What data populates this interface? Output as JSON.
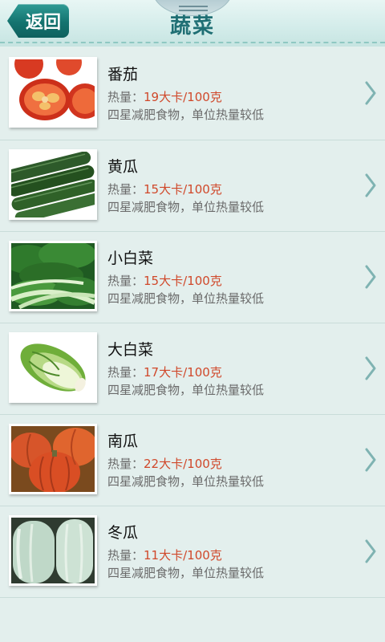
{
  "header": {
    "back_label": "返回",
    "title": "蔬菜"
  },
  "calorie_prefix": "热量：",
  "items": [
    {
      "name": "番茄",
      "calories": "19大卡/100克",
      "description": "四星减肥食物，单位热量较低",
      "image": "tomato"
    },
    {
      "name": "黄瓜",
      "calories": "15大卡/100克",
      "description": "四星减肥食物，单位热量较低",
      "image": "cucumber"
    },
    {
      "name": "小白菜",
      "calories": "15大卡/100克",
      "description": "四星减肥食物，单位热量较低",
      "image": "bok-choy"
    },
    {
      "name": "大白菜",
      "calories": "17大卡/100克",
      "description": "四星减肥食物，单位热量较低",
      "image": "napa-cabbage"
    },
    {
      "name": "南瓜",
      "calories": "22大卡/100克",
      "description": "四星减肥食物，单位热量较低",
      "image": "pumpkin"
    },
    {
      "name": "冬瓜",
      "calories": "11大卡/100克",
      "description": "四星减肥食物，单位热量较低",
      "image": "winter-melon"
    }
  ],
  "colors": {
    "accent": "#14736f",
    "calorie_value": "#d0482a",
    "background": "#e3efed"
  }
}
